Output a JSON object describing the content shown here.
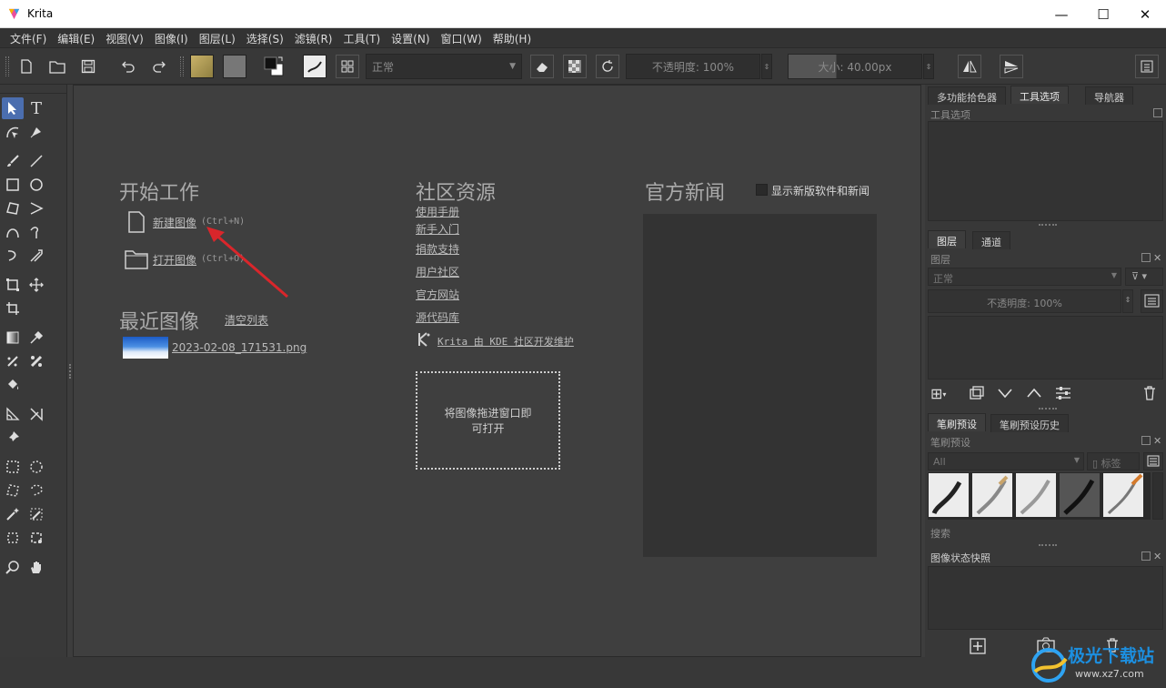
{
  "window": {
    "title": "Krita",
    "minimize": "—",
    "maximize": "☐",
    "close": "✕"
  },
  "menu": [
    "文件(F)",
    "编辑(E)",
    "视图(V)",
    "图像(I)",
    "图层(L)",
    "选择(S)",
    "滤镜(R)",
    "工具(T)",
    "设置(N)",
    "窗口(W)",
    "帮助(H)"
  ],
  "toolbar": {
    "blend_mode": "正常",
    "opacity_label": "不透明度: 100%",
    "size_label": "大小: 40.00px"
  },
  "welcome": {
    "start_heading": "开始工作",
    "new_image": "新建图像",
    "new_image_shortcut": "(Ctrl+N)",
    "open_image": "打开图像",
    "open_image_shortcut": "(Ctrl+O)",
    "recent_heading": "最近图像",
    "clear_list": "清空列表",
    "recent_file": "2023-02-08_171531.png",
    "community_heading": "社区资源",
    "community_links": [
      "使用手册",
      "新手入门",
      "捐款支持",
      "用户社区",
      "官方网站",
      "源代码库"
    ],
    "kde_link": "Krita 由 KDE 社区开发维护",
    "drop_zone_line1": "将图像拖进窗口即",
    "drop_zone_line2": "可打开",
    "news_heading": "官方新闻",
    "news_checkbox_label": "显示新版软件和新闻"
  },
  "dock": {
    "top_tabs": [
      "多功能拾色器",
      "工具选项",
      "导航器"
    ],
    "tool_options_title": "工具选项",
    "layer_tabs": [
      "图层",
      "通道"
    ],
    "layers_title": "图层",
    "layer_blend": "正常",
    "layer_opacity": "不透明度:  100%",
    "brush_tabs": [
      "笔刷预设",
      "笔刷预设历史"
    ],
    "brush_title": "笔刷预设",
    "brush_filter": "All",
    "brush_tag": "标签",
    "brush_search": "搜索",
    "snapshot_title": "图像状态快照"
  },
  "watermark": {
    "text": "极光下载站",
    "url": "www.xz7.com"
  },
  "colors": {
    "accent_selected_tool": "#4b6eaf",
    "arrow": "#d9262b",
    "fg_color": "#111111",
    "bg_color": "#ffffff"
  }
}
